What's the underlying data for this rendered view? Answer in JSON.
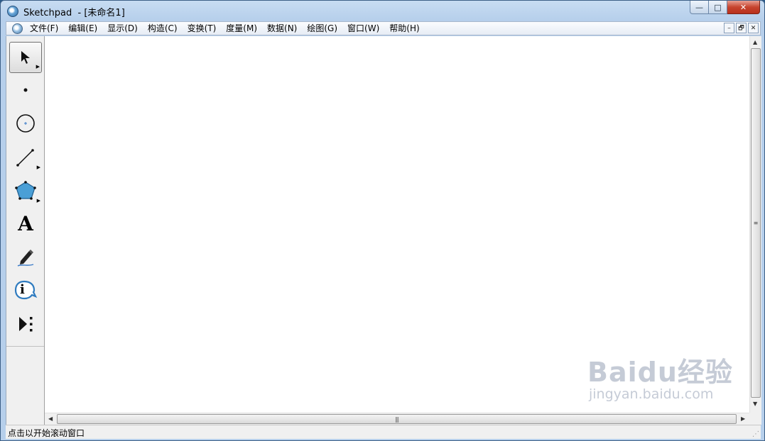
{
  "window": {
    "title": "Sketchpad  - [未命名1]",
    "buttons": {
      "minimize": "—",
      "maximize": "□",
      "close": "✕"
    }
  },
  "menubar": {
    "items": [
      "文件(F)",
      "编辑(E)",
      "显示(D)",
      "构造(C)",
      "变换(T)",
      "度量(M)",
      "数据(N)",
      "绘图(G)",
      "窗口(W)",
      "帮助(H)"
    ],
    "mdi_buttons": {
      "minimize": "–",
      "restore": "🗗",
      "close": "✕"
    }
  },
  "toolbox": {
    "tools": [
      {
        "name": "select-arrow-tool",
        "icon": "arrow-cursor-icon",
        "active": true
      },
      {
        "name": "point-tool",
        "icon": "point-icon"
      },
      {
        "name": "compass-tool",
        "icon": "circle-icon"
      },
      {
        "name": "straightedge-tool",
        "icon": "segment-icon"
      },
      {
        "name": "polygon-tool",
        "icon": "polygon-icon"
      },
      {
        "name": "text-tool",
        "icon": "text-A-icon"
      },
      {
        "name": "marker-tool",
        "icon": "marker-pen-icon"
      },
      {
        "name": "information-tool",
        "icon": "info-icon"
      },
      {
        "name": "custom-tool",
        "icon": "play-menu-icon"
      }
    ],
    "text_tool_glyph": "A",
    "info_tool_glyph": "i"
  },
  "scrollbars": {
    "grip": "≡",
    "hgrip": "|||"
  },
  "statusbar": {
    "text": "点击以开始滚动窗口"
  },
  "watermark": {
    "logo": "Baidu经验",
    "url": "jingyan.baidu.com"
  },
  "colors": {
    "polygon_fill": "#4a9fd6",
    "info_blue": "#2f7bbf",
    "marker_line": "#3a7bc8"
  }
}
